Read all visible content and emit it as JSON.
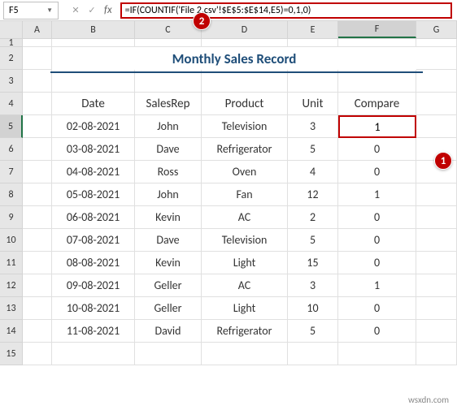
{
  "nameBox": "F5",
  "formula": "=IF(COUNTIF('File 2.csv'!$E$5:$E$14,E5)=0,1,0)",
  "fx": "fx",
  "columns": [
    "A",
    "B",
    "C",
    "D",
    "E",
    "F",
    "G"
  ],
  "rows": [
    "1",
    "2",
    "3",
    "4",
    "5",
    "6",
    "7",
    "8",
    "9",
    "10",
    "11",
    "12",
    "13",
    "14",
    "15"
  ],
  "title": "Monthly Sales Record",
  "headers": {
    "date": "Date",
    "rep": "SalesRep",
    "product": "Product",
    "unit": "Unit",
    "compare": "Compare"
  },
  "data": [
    {
      "date": "02-08-2021",
      "rep": "John",
      "product": "Television",
      "unit": "3",
      "compare": "1"
    },
    {
      "date": "03-08-2021",
      "rep": "Dave",
      "product": "Refrigerator",
      "unit": "5",
      "compare": "0"
    },
    {
      "date": "04-08-2021",
      "rep": "Ross",
      "product": "Oven",
      "unit": "4",
      "compare": "0"
    },
    {
      "date": "05-08-2021",
      "rep": "John",
      "product": "Fan",
      "unit": "12",
      "compare": "1"
    },
    {
      "date": "06-08-2021",
      "rep": "Kevin",
      "product": "AC",
      "unit": "2",
      "compare": "0"
    },
    {
      "date": "07-08-2021",
      "rep": "Dave",
      "product": "Television",
      "unit": "5",
      "compare": "0"
    },
    {
      "date": "08-08-2021",
      "rep": "Kevin",
      "product": "Light",
      "unit": "15",
      "compare": "0"
    },
    {
      "date": "09-08-2021",
      "rep": "Geller",
      "product": "AC",
      "unit": "3",
      "compare": "1"
    },
    {
      "date": "10-08-2021",
      "rep": "Geller",
      "product": "Light",
      "unit": "10",
      "compare": "0"
    },
    {
      "date": "11-08-2021",
      "rep": "David",
      "product": "Refrigerator",
      "unit": "5",
      "compare": "0"
    }
  ],
  "selectedValue": "1",
  "callouts": {
    "one": "1",
    "two": "2"
  },
  "watermark": "wsxdn.com"
}
